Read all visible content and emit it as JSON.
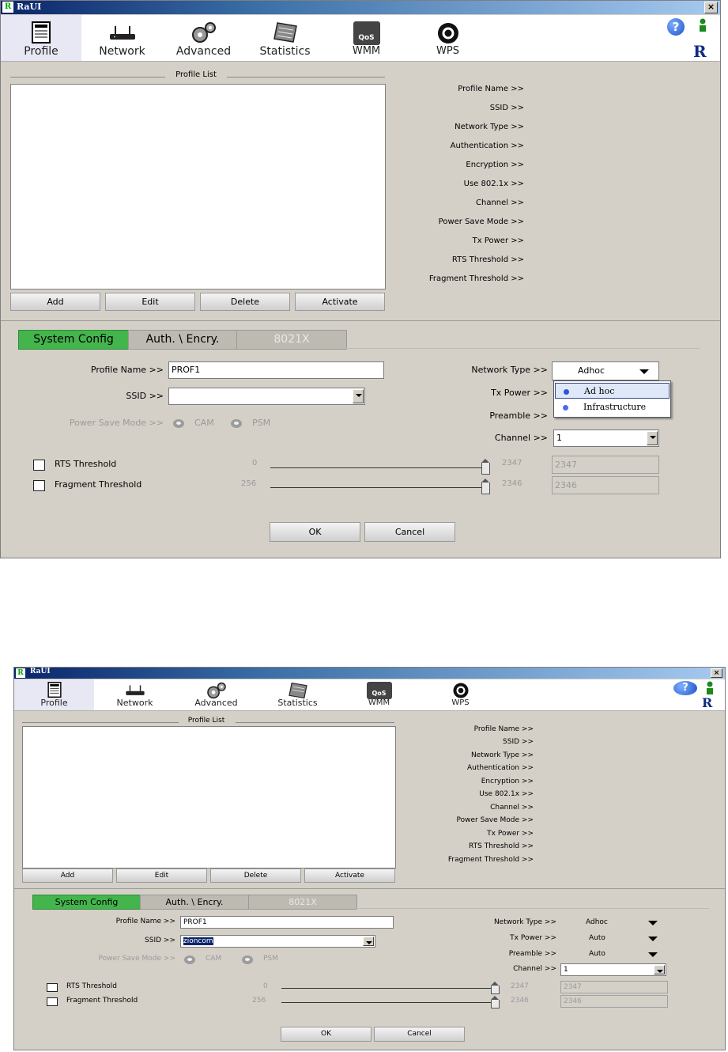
{
  "window": {
    "title": "RaUI",
    "icon_letter": "R",
    "close_glyph": "×"
  },
  "toolbar": {
    "items": [
      {
        "label": "Profile",
        "icon": "profile-icon"
      },
      {
        "label": "Network",
        "icon": "network-icon"
      },
      {
        "label": "Advanced",
        "icon": "advanced-icon"
      },
      {
        "label": "Statistics",
        "icon": "statistics-icon"
      },
      {
        "label": "WMM",
        "icon": "wmm-icon",
        "badge": "QoS"
      },
      {
        "label": "WPS",
        "icon": "wps-icon"
      }
    ],
    "help_glyph": "?",
    "logo_letter": "R"
  },
  "profile_list": {
    "title": "Profile List",
    "buttons": {
      "add": "Add",
      "edit": "Edit",
      "delete": "Delete",
      "activate": "Activate"
    }
  },
  "details": {
    "labels": [
      "Profile Name >>",
      "SSID >>",
      "Network Type >>",
      "Authentication >>",
      "Encryption >>",
      "Use 802.1x >>",
      "Channel >>",
      "Power Save Mode >>",
      "Tx Power >>",
      "RTS Threshold >>",
      "Fragment Threshold >>"
    ]
  },
  "tabs": {
    "system_config": "System Config",
    "auth_encry": "Auth. \\ Encry.",
    "x8021": "8021X"
  },
  "config": {
    "profile_name_label": "Profile Name >>",
    "ssid_label": "SSID >>",
    "power_save_label": "Power Save Mode >>",
    "cam": "CAM",
    "psm": "PSM",
    "network_type_label": "Network Type >>",
    "tx_power_label": "Tx Power >>",
    "preamble_label": "Preamble >>",
    "channel_label": "Channel >>",
    "rts_label": "RTS Threshold",
    "frag_label": "Fragment Threshold",
    "rts_min": "0",
    "rts_max": "2347",
    "rts_value": "2347",
    "frag_min": "256",
    "frag_max": "2346",
    "frag_value": "2346",
    "ok": "OK",
    "cancel": "Cancel"
  },
  "screen1": {
    "profile_name_value": "PROF1",
    "ssid_value": "",
    "network_type_value": "Adhoc",
    "channel_value": "1",
    "dropdown_options": [
      "Ad hoc",
      "Infrastructure"
    ],
    "dropdown_selected": "Ad hoc"
  },
  "screen2": {
    "profile_name_value": "PROF1",
    "ssid_value": "zioncom",
    "network_type_value": "Adhoc",
    "tx_power_value": "Auto",
    "preamble_value": "Auto",
    "channel_value": "1"
  }
}
